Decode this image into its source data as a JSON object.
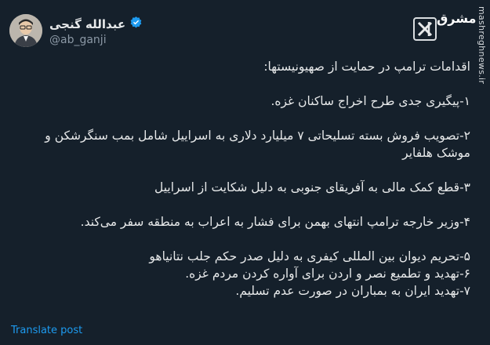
{
  "header": {
    "display_name": "عبدالله گنجی",
    "handle": "@ab_ganji"
  },
  "watermark": {
    "logo_text": "مشرق",
    "vertical_url": "mashreghnews.ir"
  },
  "post": {
    "heading": "اقدامات ترامپ در حمایت از صهیونیستها:",
    "items": [
      "۱-پیگیری جدی طرح اخراج ساکنان غزه.",
      "۲-تصویب فروش بسته تسلیحاتی ۷ میلیارد دلاری به اسراییل شامل بمب سنگرشکن و موشک هلفایر",
      "۳-قطع کمک مالی به آفریقای جنوبی به دلیل شکایت از اسراییل",
      "۴-وزیر خارجه ترامپ انتهای بهمن برای فشار به اعراب به منطقه سفر می‌کند.",
      "۵-تحریم دیوان بین المللی کیفری به دلیل صدر حکم جلب نتانیاهو",
      "۶-تهدید و تطمیع نصر و اردن برای آواره کردن مردم غزه.",
      "۷-تهدید ایران به بمباران در صورت عدم تسلیم."
    ]
  },
  "footer": {
    "translate_label": "Translate post"
  },
  "colors": {
    "background": "#15202b",
    "text": "#e7e9ea",
    "muted": "#8b98a5",
    "accent": "#1d9bf0"
  }
}
